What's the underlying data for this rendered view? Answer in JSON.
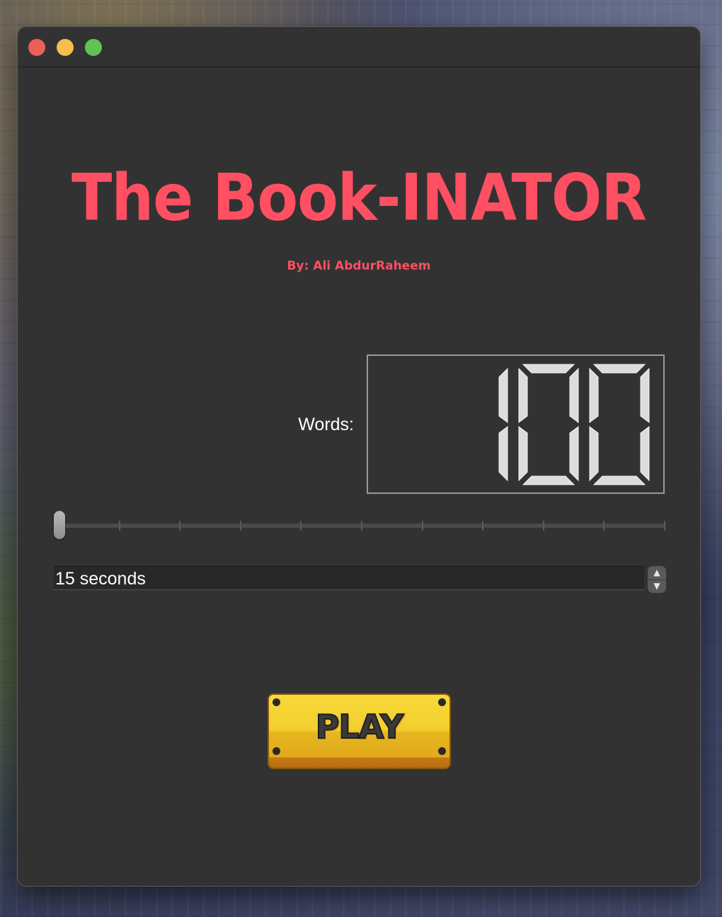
{
  "app": {
    "title": "The Book-INATOR",
    "byline": "By: Ali AbdurRaheem"
  },
  "counter": {
    "label": "Words:",
    "value": "100"
  },
  "slider": {
    "ticks": 10,
    "value_fraction": 0.0
  },
  "duration": {
    "value": "15 seconds"
  },
  "play_button": {
    "label": "PLAY"
  },
  "icons": {
    "stepper_up": "chevron-up-icon",
    "stepper_down": "chevron-down-icon"
  },
  "colors": {
    "title": "#ff4f63",
    "window_bg": "#323232",
    "play_yellow": "#f2cf2e"
  }
}
